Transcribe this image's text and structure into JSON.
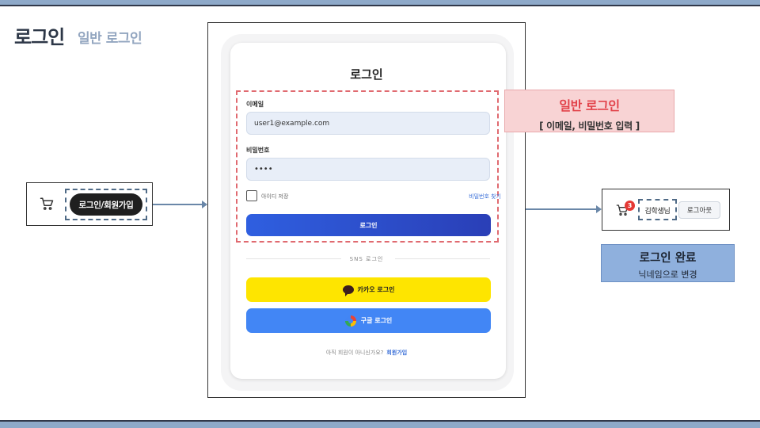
{
  "page": {
    "title": "로그인",
    "subtitle": "일반 로그인"
  },
  "header_before": {
    "login_label": "로그인/회원가입",
    "cart_icon": "cart-icon"
  },
  "login_form": {
    "title": "로그인",
    "email_label": "이메일",
    "email_value": "user1@example.com",
    "password_label": "비밀번호",
    "password_value": "••••",
    "remember_label": "아이디 저장",
    "find_password": "비밀번호 찾기",
    "submit_label": "로그인",
    "sns_label": "SNS 로그인",
    "kakao_label": "카카오 로그인",
    "google_label": "구글 로그인",
    "signup_prompt": "아직 회원이 아니신가요?",
    "signup_link": "회원가입"
  },
  "callout": {
    "title": "일반 로그인",
    "desc": "[ 이메일, 비밀번호 입력 ]"
  },
  "header_after": {
    "cart_badge": "3",
    "nickname": "김학생님",
    "logout_label": "로그아웃"
  },
  "done": {
    "title": "로그인 완료",
    "desc": "닉네임으로 변경"
  },
  "colors": {
    "accent": "#2f5fe0",
    "kakao": "#fee500",
    "google": "#4286f5",
    "callout_red": "#e2434b"
  }
}
